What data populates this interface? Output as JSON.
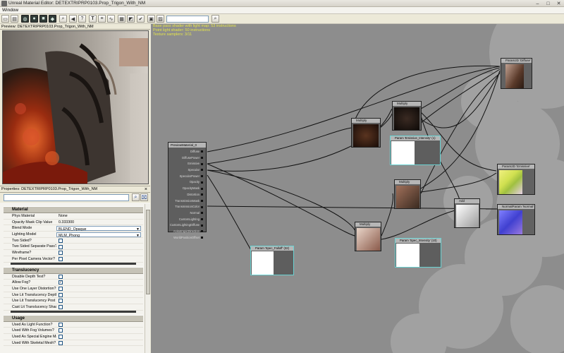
{
  "window": {
    "title": "Unreal Material Editor: DETEXTRIPRP0103.Prop_Trigon_With_NM",
    "buttons": [
      "minimize",
      "maximize",
      "close"
    ]
  },
  "menubar": {
    "items": [
      "Window"
    ]
  },
  "toolbar": {
    "icons": [
      "document-icon",
      "sphere-icon",
      "cylinder-icon",
      "cube-icon",
      "plane-icon",
      "zoom-icon",
      "back-icon",
      "help-icon",
      "text-icon",
      "expressions-icon",
      "curves-icon",
      "stats-icon",
      "realtime-icon",
      "apply-icon",
      "live-preview-icon",
      "clean-icon"
    ],
    "search_value": ""
  },
  "preview": {
    "header": "Preview: DETEXTRIPRP0103.Prop_Trigon_With_NM"
  },
  "properties": {
    "header": "Properties: DETEXTRIPRP0103.Prop_Trigon_With_NM",
    "close": "×",
    "categories": [
      {
        "name": "Material",
        "rows": [
          {
            "label": "Phys Material",
            "value": "None",
            "type": "text"
          },
          {
            "label": "Opacity Mask Clip Value",
            "value": "0.333300",
            "type": "text"
          },
          {
            "label": "Blend Mode",
            "value": "BLEND_Opaque",
            "type": "dropdown"
          },
          {
            "label": "Lighting Model",
            "value": "MLM_Phong",
            "type": "dropdown"
          },
          {
            "label": "Two Sided?",
            "value": "",
            "type": "check",
            "checked": false
          },
          {
            "label": "Two Sided Separate Pass?",
            "value": "",
            "type": "check",
            "checked": false
          },
          {
            "label": "Wireframe?",
            "value": "",
            "type": "check",
            "checked": false
          },
          {
            "label": "Per Pixel Camera Vector?",
            "value": "",
            "type": "check",
            "checked": false
          }
        ]
      },
      {
        "name": "Translucency",
        "rows": [
          {
            "label": "Disable Depth Test?",
            "value": "",
            "type": "check",
            "checked": false
          },
          {
            "label": "Allow Fog?",
            "value": "",
            "type": "check",
            "checked": true
          },
          {
            "label": "Use One Layer Distortion?",
            "value": "",
            "type": "check",
            "checked": false
          },
          {
            "label": "Use Lit Translucency Depth P",
            "value": "",
            "type": "check",
            "checked": false
          },
          {
            "label": "Use Lit Translucency Post Re",
            "value": "",
            "type": "check",
            "checked": false
          },
          {
            "label": "Cast Lit Translucency Shadov",
            "value": "",
            "type": "check",
            "checked": false
          }
        ]
      },
      {
        "name": "Usage",
        "rows": [
          {
            "label": "Used As Light Function?",
            "value": "",
            "type": "check",
            "checked": false
          },
          {
            "label": "Used With Fog Volumes?",
            "value": "",
            "type": "check",
            "checked": false
          },
          {
            "label": "Used As Special Engine Mate",
            "value": "",
            "type": "check",
            "checked": false
          },
          {
            "label": "Used With Skeletal Mesh?",
            "value": "",
            "type": "check",
            "checked": false
          }
        ]
      }
    ]
  },
  "canvas": {
    "stats": [
      "Base pass shader with light map: 53 instructions",
      "Point light shader: 50 instructions",
      "Texture samplers: 3/11"
    ],
    "main_node": {
      "title": "PreviewMaterial_0",
      "inputs": [
        "Diffuse",
        "DiffusePower",
        "Emissive",
        "Specular",
        "SpecularPower",
        "Opacity",
        "OpacityMask",
        "Distortion",
        "TransmissionMask",
        "TransmissionColor",
        "Normal",
        "CustomLighting",
        "CustomLightingDiffuse",
        "AnisotropicDirection",
        "WorldPositionOffset"
      ]
    },
    "nodes": {
      "multiply_a": "Multiply",
      "multiply_b": "Multiply",
      "multiply_c": "Multiply",
      "multiply_d": "Multiply",
      "add": "Add",
      "param_emissive": "Param 'Emissive_Intensity' (1)",
      "param_spec_falloff": "Param 'Spec_Falloff' (32)",
      "param_spec_intensity": "Param 'Spec_Intensity' (10)",
      "tex_diffuse": "Param2D 'Diffuse'",
      "tex_emissive": "Param2D 'Emissive'",
      "tex_normal": "NormalParam 'Normal'"
    }
  },
  "colors": {
    "canvas_bg": "#8d8d8d",
    "stats_text": "#e5e54a",
    "node_header": "#b6b6b6",
    "node_body": "#5e5e5e",
    "param_outline": "#6ad3d3"
  }
}
